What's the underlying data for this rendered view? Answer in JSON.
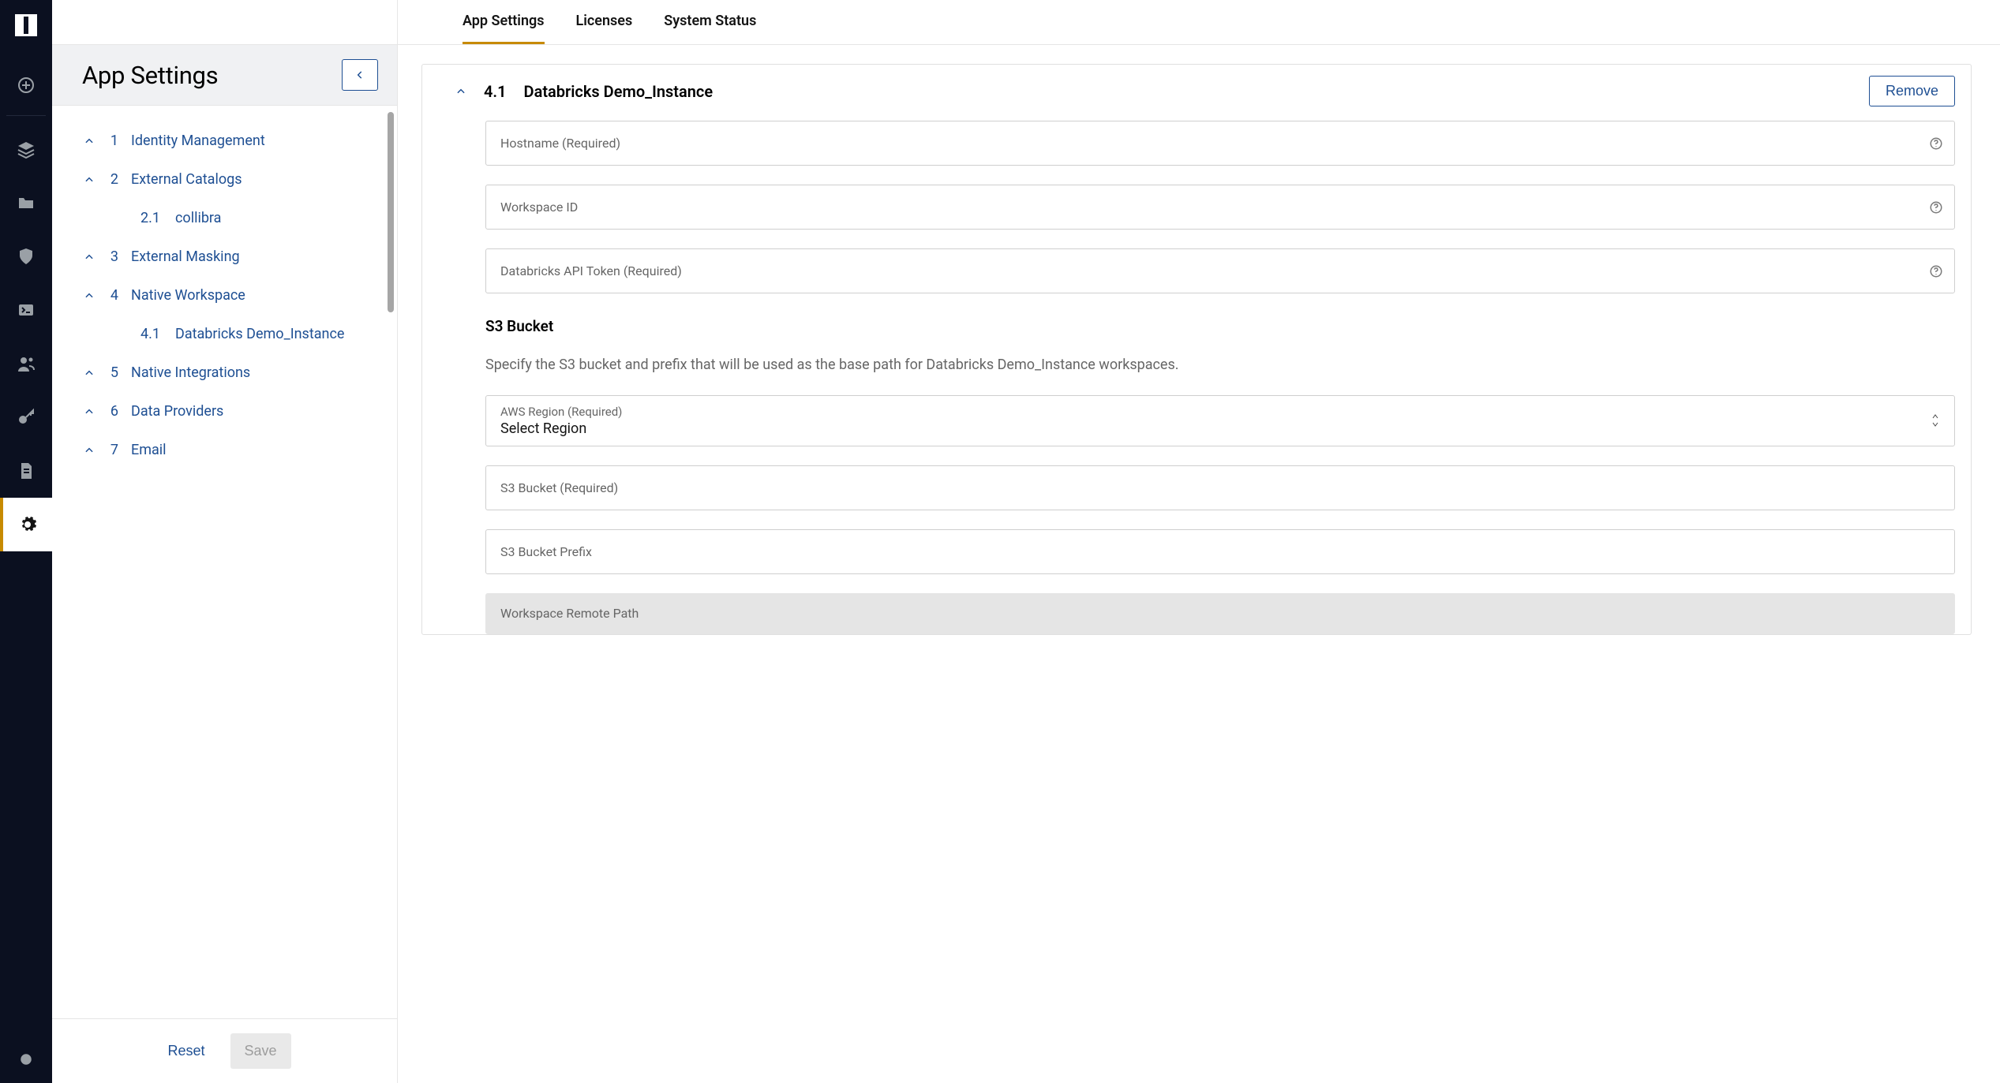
{
  "colors": {
    "accent": "#c78a00",
    "link": "#1e4f93"
  },
  "rail": {
    "items": [
      {
        "name": "add-icon"
      },
      {
        "name": "layers-icon"
      },
      {
        "name": "folder-icon"
      },
      {
        "name": "shield-icon"
      },
      {
        "name": "terminal-icon"
      },
      {
        "name": "users-icon"
      },
      {
        "name": "key-icon"
      },
      {
        "name": "file-icon"
      },
      {
        "name": "gear-icon",
        "active": true
      }
    ]
  },
  "sidebar": {
    "title": "App Settings",
    "reset": "Reset",
    "save": "Save",
    "items": [
      {
        "num": "1",
        "label": "Identity Management"
      },
      {
        "num": "2",
        "label": "External Catalogs",
        "children": [
          {
            "num": "2.1",
            "label": "collibra"
          }
        ]
      },
      {
        "num": "3",
        "label": "External Masking"
      },
      {
        "num": "4",
        "label": "Native Workspace",
        "children": [
          {
            "num": "4.1",
            "label": "Databricks Demo_Instance"
          }
        ]
      },
      {
        "num": "5",
        "label": "Native Integrations"
      },
      {
        "num": "6",
        "label": "Data Providers"
      },
      {
        "num": "7",
        "label": "Email"
      }
    ]
  },
  "tabs": [
    {
      "label": "App Settings",
      "active": true
    },
    {
      "label": "Licenses"
    },
    {
      "label": "System Status"
    }
  ],
  "main": {
    "card": {
      "index": "4.1",
      "title": "Databricks Demo_Instance",
      "remove": "Remove",
      "fields": {
        "hostname_label": "Hostname (Required)",
        "workspace_id_label": "Workspace ID",
        "api_token_label": "Databricks API Token (Required)",
        "s3_heading": "S3 Bucket",
        "s3_desc": "Specify the S3 bucket and prefix that will be used as the base path for Databricks Demo_Instance workspaces.",
        "region_label": "AWS Region (Required)",
        "region_value": "Select Region",
        "bucket_label": "S3 Bucket (Required)",
        "prefix_label": "S3 Bucket Prefix",
        "remote_path_label": "Workspace Remote Path"
      }
    }
  }
}
